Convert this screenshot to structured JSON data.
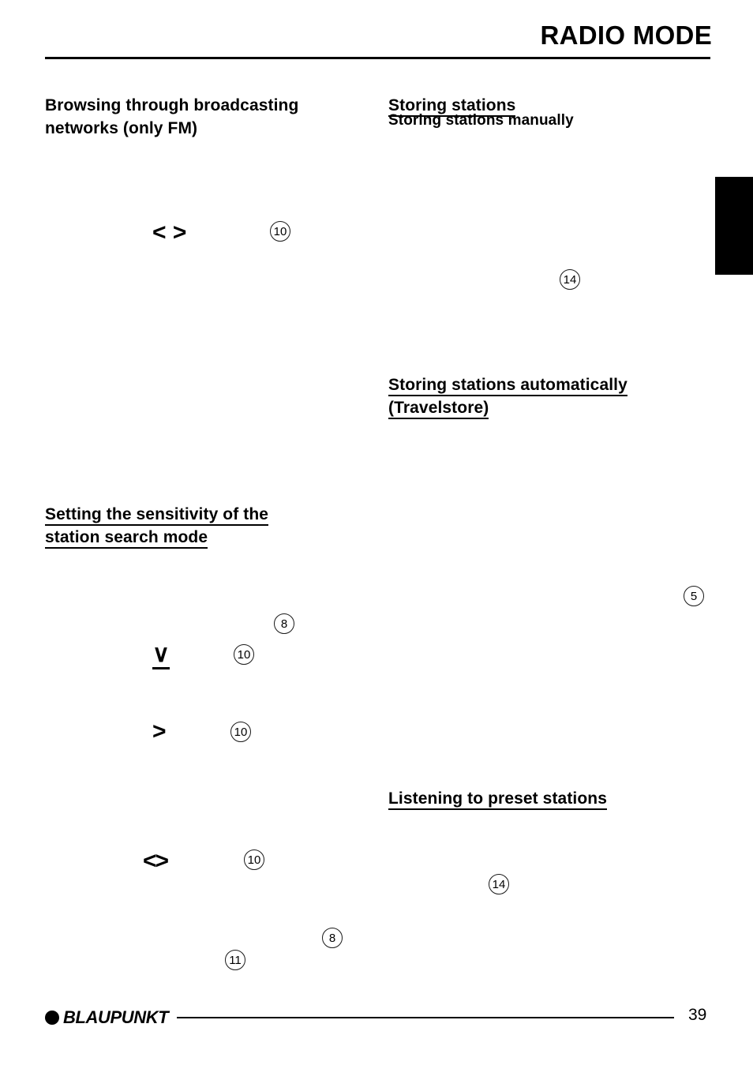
{
  "document": {
    "header_title": "RADIO MODE",
    "page_number": "39"
  },
  "left_column": {
    "headings": [
      {
        "id": "browsing-networks",
        "text": "Browsing through broadcasting\nnetworks (only FM)",
        "underlined": false,
        "level": "main"
      },
      {
        "id": "setting-sensitivity",
        "text": "Setting the sensitivity of the\nstation search mode",
        "underlined": true,
        "level": "main"
      }
    ],
    "glyphs": [
      {
        "id": "left-right-arrows",
        "text": "<  >",
        "underlined": false
      },
      {
        "id": "down-chevron",
        "text": "∨",
        "underlined": true
      },
      {
        "id": "right-chevron",
        "text": ">",
        "underlined": false
      },
      {
        "id": "left-right-pair",
        "text": "<>",
        "underlined": false
      }
    ],
    "refs": [
      {
        "id": "ref-10-a",
        "label": "10"
      },
      {
        "id": "ref-8-a",
        "label": "8"
      },
      {
        "id": "ref-10-b",
        "label": "10"
      },
      {
        "id": "ref-10-c",
        "label": "10"
      },
      {
        "id": "ref-10-d",
        "label": "10"
      },
      {
        "id": "ref-8-b",
        "label": "8"
      },
      {
        "id": "ref-11",
        "label": "11"
      }
    ]
  },
  "right_column": {
    "headings": [
      {
        "id": "storing-stations",
        "text": "Storing stations",
        "underlined": true,
        "level": "main"
      },
      {
        "id": "storing-manually",
        "text": "Storing stations manually",
        "underlined": false,
        "level": "sub"
      },
      {
        "id": "storing-automatically",
        "text": "Storing stations automatically\n(Travelstore)",
        "underlined": true,
        "level": "main"
      },
      {
        "id": "listening-presets",
        "text": "Listening to preset stations",
        "underlined": true,
        "level": "main"
      }
    ],
    "refs": [
      {
        "id": "ref-14-a",
        "label": "14"
      },
      {
        "id": "ref-5",
        "label": "5"
      },
      {
        "id": "ref-14-b",
        "label": "14"
      }
    ]
  },
  "footer": {
    "brand": "BLAUPUNKT"
  },
  "colors": {
    "ink": "#000000",
    "paper": "#ffffff",
    "tab": "#000000"
  }
}
